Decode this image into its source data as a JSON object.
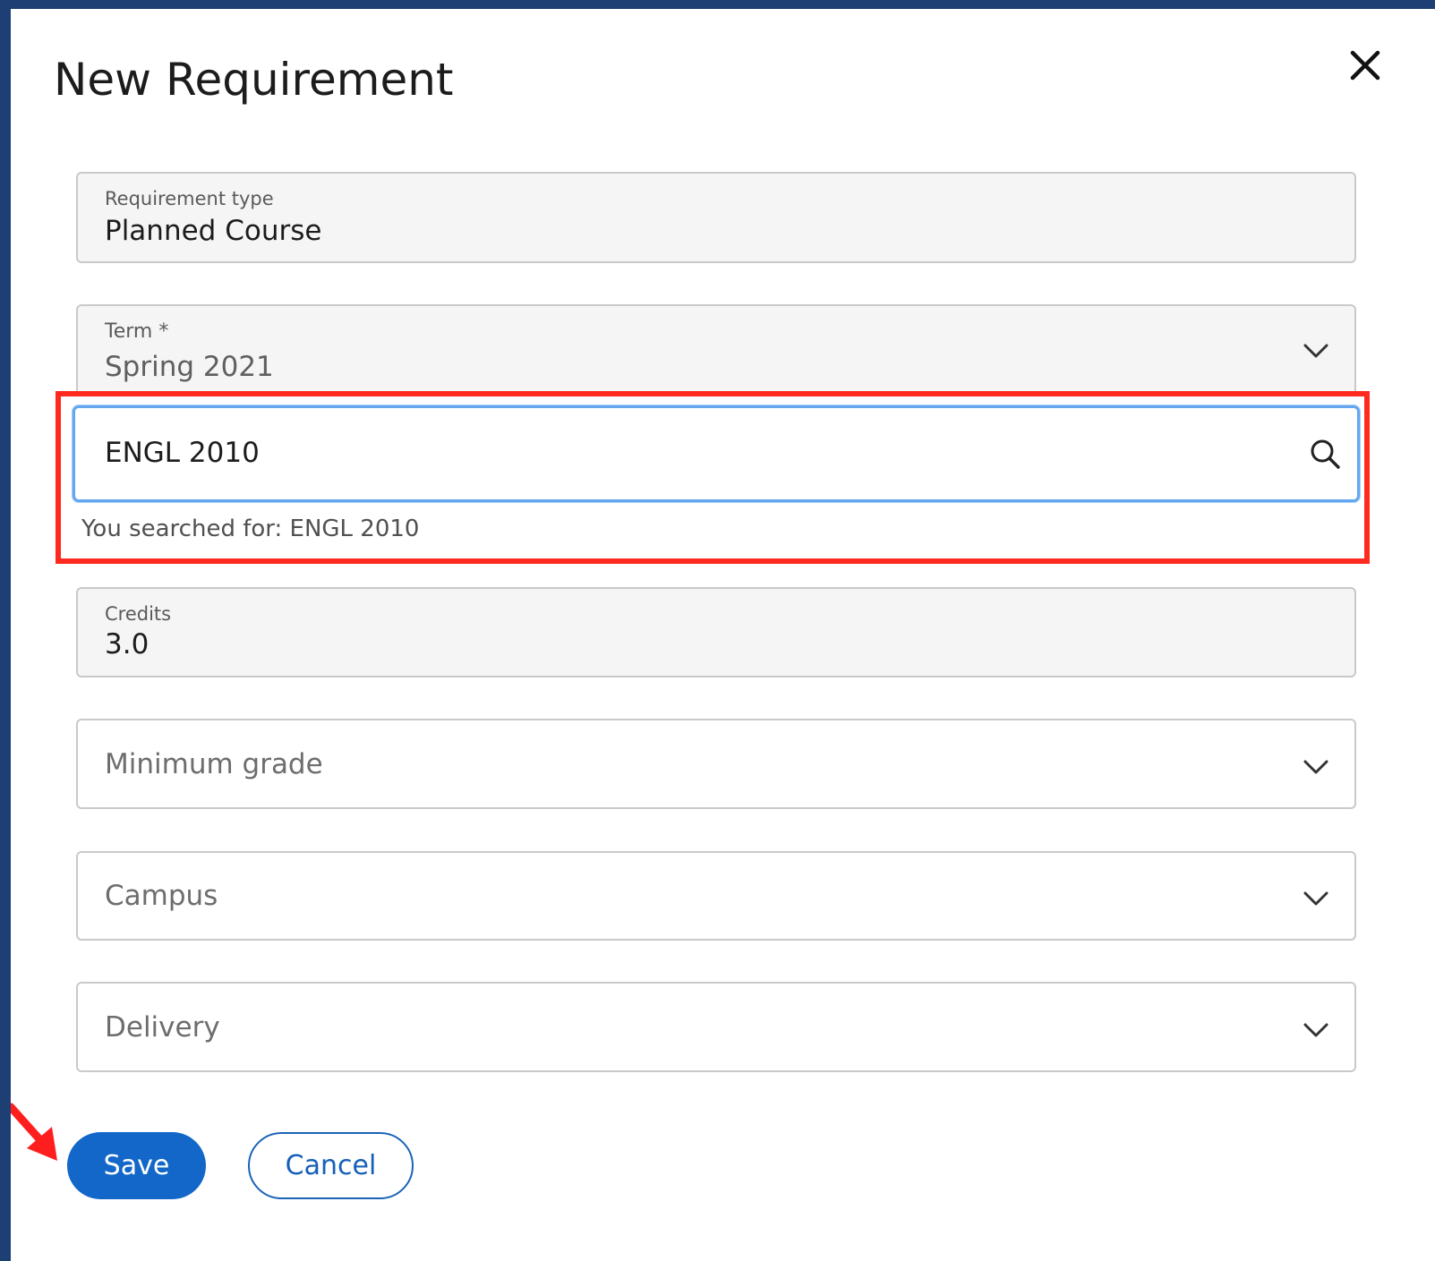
{
  "dialog": {
    "title": "New Requirement",
    "close_icon": "close-icon"
  },
  "fields": {
    "requirement_type": {
      "label": "Requirement type",
      "value": "Planned Course"
    },
    "term": {
      "label": "Term *",
      "value": "Spring 2021",
      "icon": "chevron-down-icon"
    },
    "course_search": {
      "value": "ENGL 2010",
      "icon": "search-icon",
      "hint": "You searched for: ENGL 2010"
    },
    "credits": {
      "label": "Credits",
      "value": "3.0"
    },
    "minimum_grade": {
      "placeholder": "Minimum grade",
      "icon": "chevron-down-icon"
    },
    "campus": {
      "placeholder": "Campus",
      "icon": "chevron-down-icon"
    },
    "delivery": {
      "placeholder": "Delivery",
      "icon": "chevron-down-icon"
    }
  },
  "actions": {
    "save_label": "Save",
    "cancel_label": "Cancel"
  },
  "colors": {
    "background": "#1e3f73",
    "primary": "#1267c8",
    "focus_border": "#65a7ee",
    "highlight_annotation": "#ff2a1f"
  }
}
